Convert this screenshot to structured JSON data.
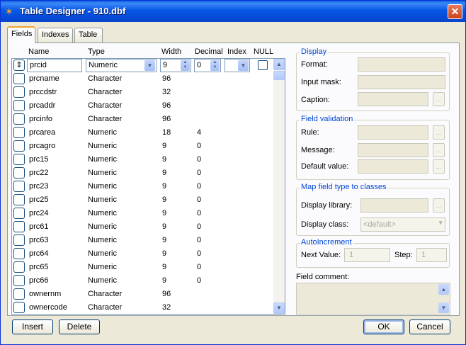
{
  "window": {
    "title": "Table Designer - 910.dbf",
    "close_label": "✕"
  },
  "tabs": [
    {
      "label": "Fields"
    },
    {
      "label": "Indexes"
    },
    {
      "label": "Table"
    }
  ],
  "grid": {
    "headers": {
      "name": "Name",
      "type": "Type",
      "width": "Width",
      "decimal": "Decimal",
      "index": "Index",
      "null": "NULL"
    },
    "current": {
      "name": "prcid",
      "type": "Numeric",
      "width": "9",
      "decimal": "0"
    },
    "rows": [
      {
        "name": "prcname",
        "type": "Character",
        "width": "96",
        "decimal": ""
      },
      {
        "name": "prccdstr",
        "type": "Character",
        "width": "32",
        "decimal": ""
      },
      {
        "name": "prcaddr",
        "type": "Character",
        "width": "96",
        "decimal": ""
      },
      {
        "name": "prcinfo",
        "type": "Character",
        "width": "96",
        "decimal": ""
      },
      {
        "name": "prcarea",
        "type": "Numeric",
        "width": "18",
        "decimal": "4"
      },
      {
        "name": "prcagro",
        "type": "Numeric",
        "width": "9",
        "decimal": "0"
      },
      {
        "name": "prc15",
        "type": "Numeric",
        "width": "9",
        "decimal": "0"
      },
      {
        "name": "prc22",
        "type": "Numeric",
        "width": "9",
        "decimal": "0"
      },
      {
        "name": "prc23",
        "type": "Numeric",
        "width": "9",
        "decimal": "0"
      },
      {
        "name": "prc25",
        "type": "Numeric",
        "width": "9",
        "decimal": "0"
      },
      {
        "name": "prc24",
        "type": "Numeric",
        "width": "9",
        "decimal": "0"
      },
      {
        "name": "prc61",
        "type": "Numeric",
        "width": "9",
        "decimal": "0"
      },
      {
        "name": "prc63",
        "type": "Numeric",
        "width": "9",
        "decimal": "0"
      },
      {
        "name": "prc64",
        "type": "Numeric",
        "width": "9",
        "decimal": "0"
      },
      {
        "name": "prc65",
        "type": "Numeric",
        "width": "9",
        "decimal": "0"
      },
      {
        "name": "prc66",
        "type": "Numeric",
        "width": "9",
        "decimal": "0"
      },
      {
        "name": "ownernm",
        "type": "Character",
        "width": "96",
        "decimal": ""
      },
      {
        "name": "ownercode",
        "type": "Character",
        "width": "32",
        "decimal": ""
      }
    ]
  },
  "display": {
    "title": "Display",
    "format": "Format:",
    "input_mask": "Input mask:",
    "caption": "Caption:"
  },
  "validation": {
    "title": "Field validation",
    "rule": "Rule:",
    "message": "Message:",
    "default_value": "Default value:"
  },
  "mapping": {
    "title": "Map field type to classes",
    "library": "Display library:",
    "class": "Display class:",
    "class_value": "<default>"
  },
  "autoinc": {
    "title": "AutoIncrement",
    "next_value": "Next Value:",
    "next_value_val": "1",
    "step": "Step:",
    "step_val": "1"
  },
  "comment": {
    "label": "Field comment:"
  },
  "buttons": {
    "insert": "Insert",
    "delete": "Delete",
    "ok": "OK",
    "cancel": "Cancel"
  },
  "ellipsis": "...",
  "icons": {
    "dropdown": "▼",
    "spin_up": "▲",
    "spin_down": "▼",
    "scroll_up": "▲",
    "scroll_down": "▼",
    "mover": "⇕",
    "app": "✶"
  },
  "colors": {
    "title_bar": "#0858e6",
    "group_title": "#0046d5",
    "tab_highlight": "#f1a22d"
  }
}
